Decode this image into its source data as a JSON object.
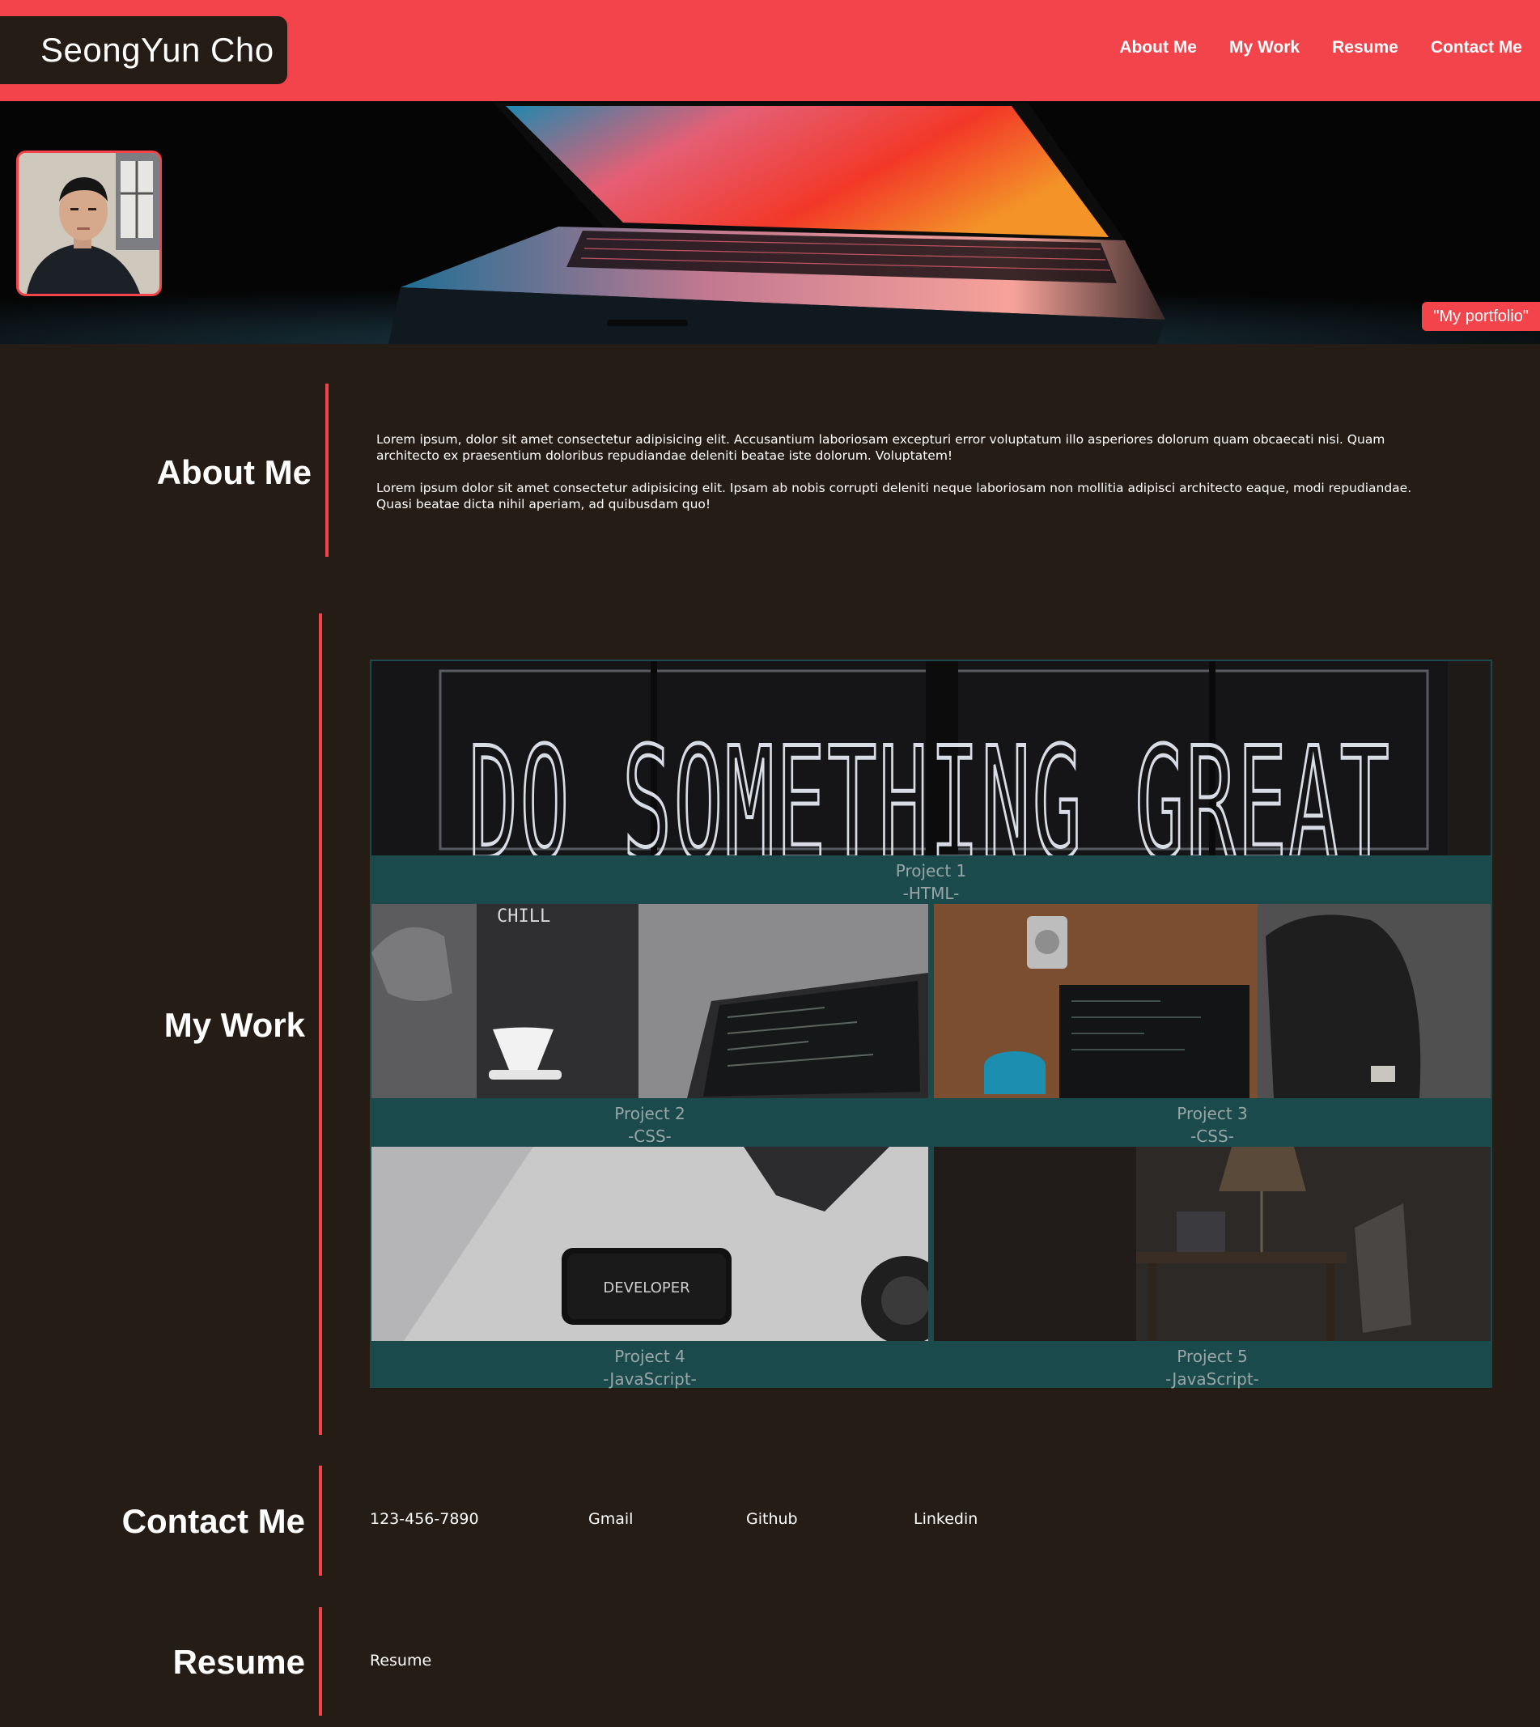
{
  "header": {
    "brand": "SeongYun Cho",
    "nav": [
      "About Me",
      "My Work",
      "Resume",
      "Contact Me"
    ]
  },
  "hero": {
    "tag": "\"My portfolio\""
  },
  "about": {
    "title": "About Me",
    "paragraphs": [
      "Lorem ipsum, dolor sit amet consectetur adipisicing elit. Accusantium laboriosam excepturi error voluptatum illo asperiores dolorum quam obcaecati nisi. Quam architecto ex praesentium doloribus repudiandae deleniti beatae iste dolorum. Voluptatem!",
      "Lorem ipsum dolor sit amet consectetur adipisicing elit. Ipsam ab nobis corrupti deleniti neque laboriosam non mollitia adipisci architecto eaque, modi repudiandae. Quasi beatae dicta nihil aperiam, ad quibusdam quo!"
    ]
  },
  "work": {
    "title": "My Work",
    "projects": [
      {
        "name": "Project 1",
        "tech": "-HTML-",
        "image_text": "DO SOMETHING GREAT"
      },
      {
        "name": "Project 2",
        "tech": "-CSS-",
        "image_text": "CHILL"
      },
      {
        "name": "Project 3",
        "tech": "-CSS-"
      },
      {
        "name": "Project 4",
        "tech": "-JavaScript-",
        "image_text": "DEVELOPER"
      },
      {
        "name": "Project 5",
        "tech": "-JavaScript-"
      }
    ]
  },
  "contact": {
    "title": "Contact Me",
    "links": [
      "123-456-7890",
      "Gmail",
      "Github",
      "Linkedin"
    ]
  },
  "resume": {
    "title": "Resume",
    "link": "Resume"
  },
  "colors": {
    "accent": "#f2444a",
    "background": "#251c16",
    "card": "#1a4a4c",
    "caption": "#9aa6a6"
  }
}
